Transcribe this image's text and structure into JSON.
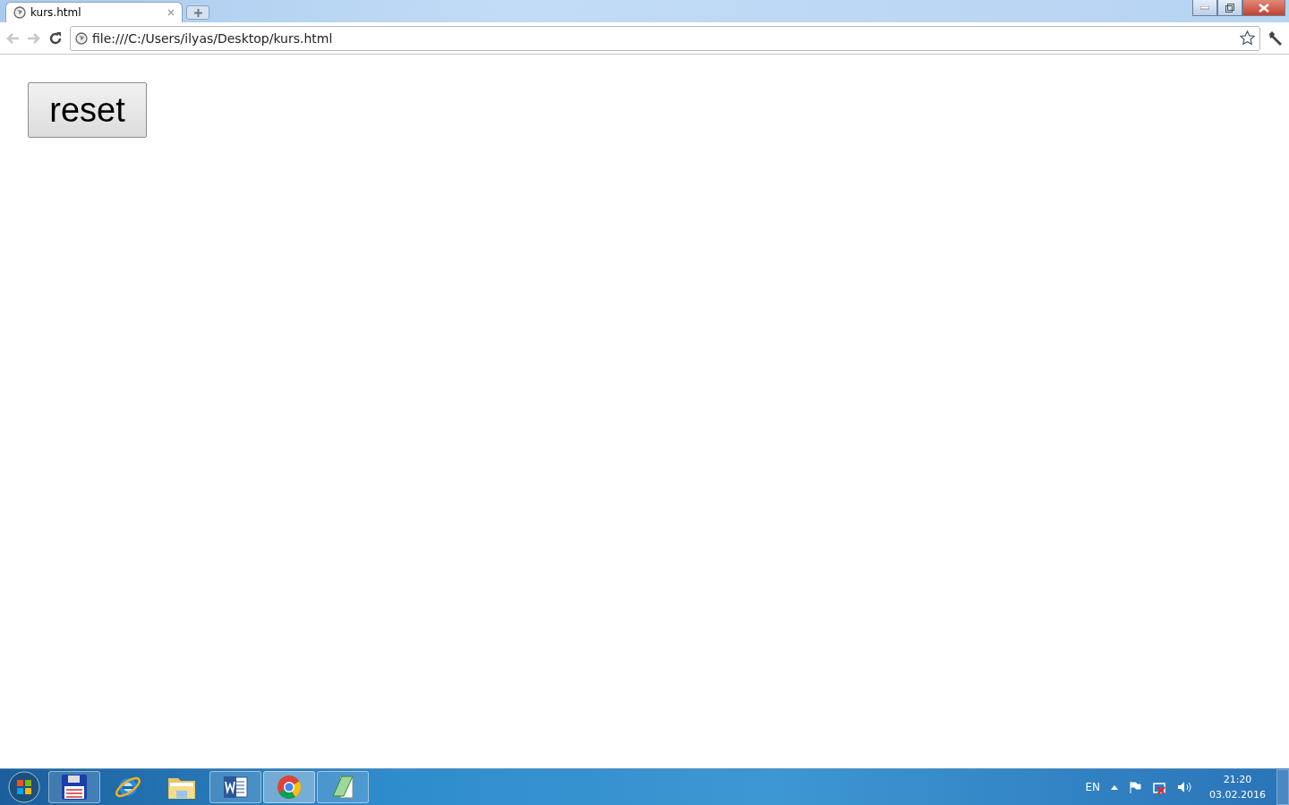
{
  "browser": {
    "tabs": [
      {
        "title": "kurs.html",
        "selected": true
      }
    ],
    "address": "file:///C:/Users/ilyas/Desktop/kurs.html"
  },
  "page": {
    "button": "reset"
  },
  "taskbar": {
    "items": [
      {
        "kind": "save",
        "open": true,
        "selected": false
      },
      {
        "kind": "ie",
        "open": false,
        "selected": false
      },
      {
        "kind": "folder",
        "open": false,
        "selected": false
      },
      {
        "kind": "word",
        "open": true,
        "selected": false
      },
      {
        "kind": "chrome",
        "open": true,
        "selected": true
      },
      {
        "kind": "notepad",
        "open": true,
        "selected": false
      }
    ],
    "language": "EN",
    "time": "21:20",
    "date": "03.02.2016"
  }
}
